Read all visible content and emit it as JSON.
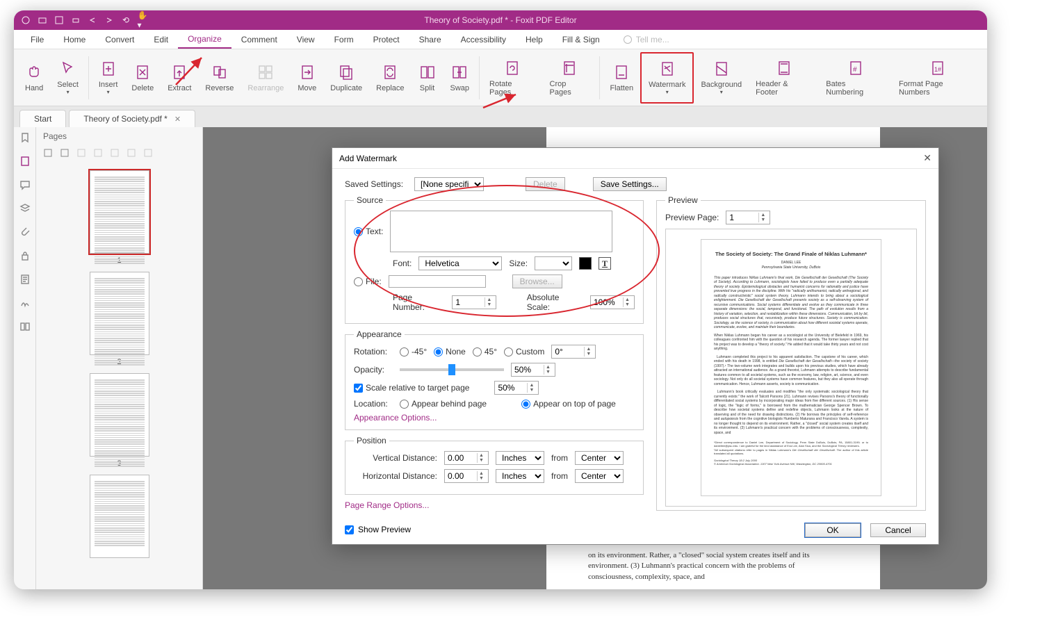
{
  "app": {
    "title": "Theory of Society.pdf * - Foxit PDF Editor"
  },
  "menu": {
    "items": [
      "File",
      "Home",
      "Convert",
      "Edit",
      "Organize",
      "Comment",
      "View",
      "Form",
      "Protect",
      "Share",
      "Accessibility",
      "Help",
      "Fill & Sign"
    ],
    "active": "Organize",
    "tellme": "Tell me..."
  },
  "ribbon": {
    "hand": "Hand",
    "select": "Select",
    "insert": "Insert",
    "delete": "Delete",
    "extract": "Extract",
    "reverse": "Reverse",
    "rearrange": "Rearrange",
    "move": "Move",
    "duplicate": "Duplicate",
    "replace": "Replace",
    "split": "Split",
    "swap": "Swap",
    "rotate": "Rotate Pages",
    "crop": "Crop Pages",
    "flatten": "Flatten",
    "watermark": "Watermark",
    "background": "Background",
    "headerfooter": "Header & Footer",
    "bates": "Bates Numbering",
    "format": "Format Page Numbers"
  },
  "tabs": {
    "start": "Start",
    "doc": "Theory of Society.pdf *"
  },
  "pagesPanel": {
    "title": "Pages",
    "p1": "1",
    "p2": "2",
    "p3": "3"
  },
  "docSnippet": "on its environment. Rather, a \"closed\" social system creates itself and its environment. (3) Luhmann's practical concern with the problems of consciousness, complexity, space, and",
  "dialog": {
    "title": "Add Watermark",
    "savedSettingsLabel": "Saved Settings:",
    "savedSettingsValue": "[None specified]",
    "deleteBtn": "Delete",
    "saveBtn": "Save Settings...",
    "source": {
      "legend": "Source",
      "textLabel": "Text:",
      "fontLabel": "Font:",
      "fontValue": "Helvetica",
      "sizeLabel": "Size:",
      "fileLabel": "File:",
      "browseBtn": "Browse...",
      "pageNumLabel": "Page Number:",
      "pageNumValue": "1",
      "absScaleLabel": "Absolute Scale:",
      "absScaleValue": "100%"
    },
    "appearance": {
      "legend": "Appearance",
      "rotationLabel": "Rotation:",
      "neg45": "-45°",
      "none": "None",
      "pos45": "45°",
      "custom": "Custom",
      "customValue": "0°",
      "opacityLabel": "Opacity:",
      "opacityValue": "50%",
      "scaleLabel": "Scale relative to target page",
      "scaleValue": "50%",
      "locationLabel": "Location:",
      "behind": "Appear behind page",
      "ontop": "Appear on top of page",
      "optionsLink": "Appearance Options..."
    },
    "position": {
      "legend": "Position",
      "vdistLabel": "Vertical Distance:",
      "hdistLabel": "Horizontal Distance:",
      "distValue": "0.00",
      "unit": "Inches",
      "fromLabel": "from",
      "fromValue": "Center"
    },
    "rangeLink": "Page Range Options...",
    "showPreview": "Show Preview",
    "preview": {
      "legend": "Preview",
      "pageLabel": "Preview Page:",
      "pageValue": "1",
      "title": "The Society of Society: The Grand Finale of Niklas Luhmann*",
      "author": "DANIEL LEE",
      "inst": "Pennsylvania State University, DuBois"
    },
    "ok": "OK",
    "cancel": "Cancel"
  }
}
